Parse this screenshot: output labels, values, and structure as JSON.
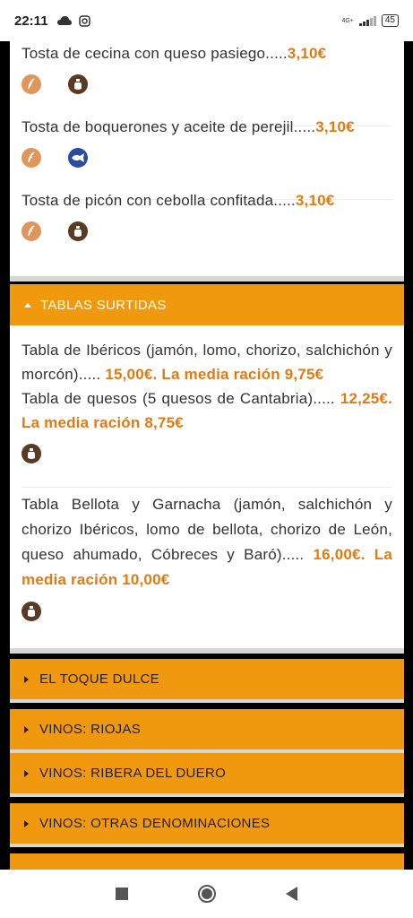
{
  "status_bar": {
    "time": "22:11",
    "network": "4G+",
    "battery": "45"
  },
  "tostas": [
    {
      "name": "Tosta de cecina con queso pasiego.....",
      "price": "3,10€",
      "allergens": [
        "gluten-icon",
        "milk-icon"
      ]
    },
    {
      "name": "Tosta de boquerones y aceite de perejil.....",
      "price": "3,10€",
      "allergens": [
        "gluten-icon",
        "fish-icon"
      ]
    },
    {
      "name": "Tosta de picón con cebolla confitada.....",
      "price": "3,10€",
      "allergens": [
        "gluten-icon",
        "milk-icon"
      ]
    }
  ],
  "tablas": {
    "header": "TABLAS SURTIDAS",
    "items": [
      {
        "text": "Tabla de Ibéricos (jamón, lomo, chorizo, salchichón y morcón).....",
        "price": "15,00€. La media ración 9,75€"
      },
      {
        "text": "Tabla de quesos (5 quesos de Cantabria).....",
        "price": "12,25€. La media ración 8,75€"
      },
      {
        "text": "Tabla Bellota y Garnacha (jamón, salchichón y chorizo Ibéricos, lomo de bellota, chorizo de León, queso ahumado, Cóbreces y Baró).....",
        "price": "16,00€. La media ración 10,00€"
      }
    ]
  },
  "sections": [
    "EL TOQUE DULCE",
    "VINOS: RIOJAS",
    "VINOS: RIBERA DEL DUERO",
    "VINOS: OTRAS DENOMINACIONES"
  ],
  "colors": {
    "accent": "#f0990f",
    "price": "#e07b14",
    "gluten": "#e0955a",
    "milk": "#5a3a22",
    "fish": "#2a4ca0"
  }
}
